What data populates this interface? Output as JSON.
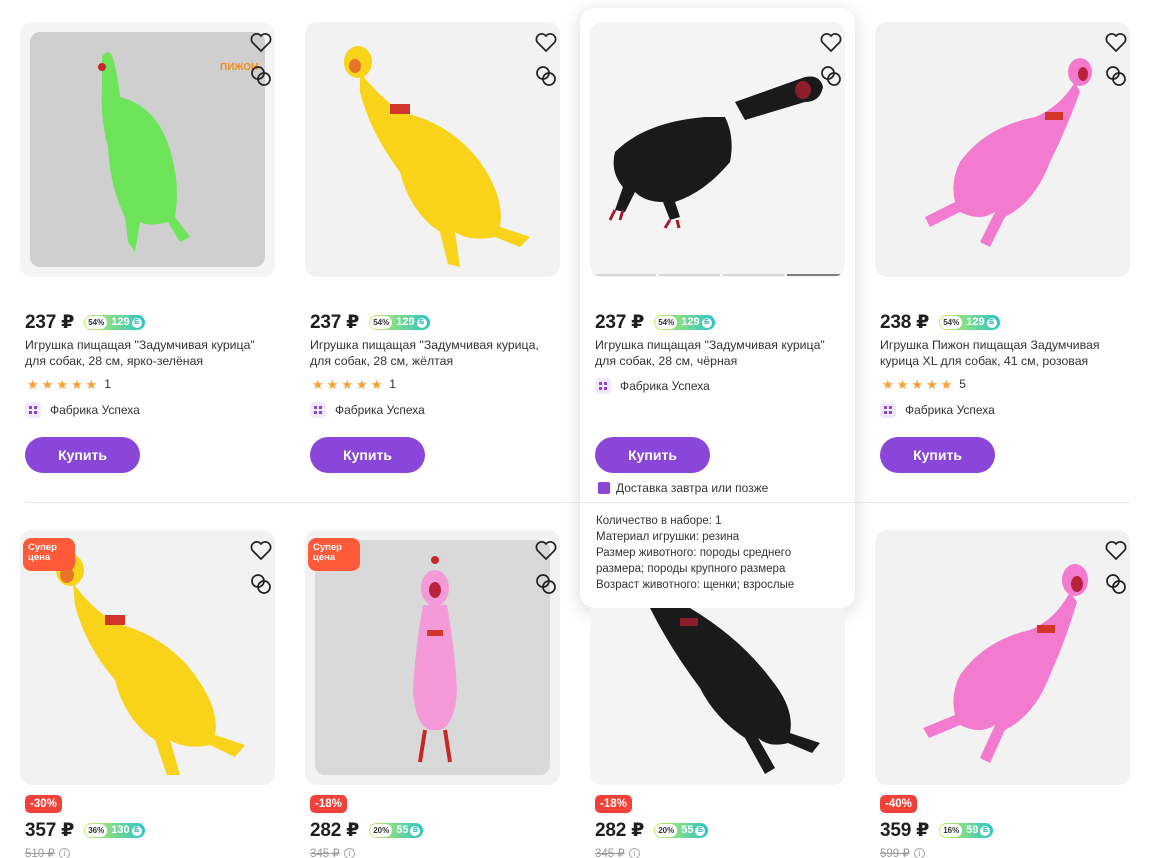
{
  "currency": "₽",
  "products": [
    {
      "price": "237 ₽",
      "bonus_pct": "54%",
      "bonus_amt": "129",
      "title": "Игрушка пищащая \"Задумчивая курица\" для собак, 28 см, ярко-зелёная",
      "rating_count": "1",
      "seller": "Фабрика Успеха",
      "buy": "Купить",
      "body_color": "#6ee45b",
      "brand_label": "ПИЖОН"
    },
    {
      "price": "237 ₽",
      "bonus_pct": "54%",
      "bonus_amt": "129",
      "title": "Игрушка пищащая \"Задумчивая курица, для собак, 28 см, жёлтая",
      "rating_count": "1",
      "seller": "Фабрика Успеха",
      "buy": "Купить",
      "body_color": "#f8d31a"
    },
    {
      "price": "237 ₽",
      "bonus_pct": "54%",
      "bonus_amt": "129",
      "title": "Игрушка пищащая \"Задумчивая курица\" для собак, 28 см, чёрная",
      "seller": "Фабрика Успеха",
      "buy": "Купить",
      "body_color": "#1a1a1a",
      "delivery": "Доставка завтра или позже",
      "specs": [
        "Количество в наборе: 1",
        "Материал игрушки: резина",
        "Размер животного: породы среднего размера; породы крупного размера",
        "Возраст животного: щенки; взрослые"
      ]
    },
    {
      "price": "238 ₽",
      "bonus_pct": "54%",
      "bonus_amt": "129",
      "title": "Игрушка Пижон пищащая Задумчивая курица XL для собак, 41 см, розовая",
      "rating_count": "5",
      "seller": "Фабрика Успеха",
      "buy": "Купить",
      "body_color": "#f27bd0"
    },
    {
      "promo": "Супер цена",
      "discount": "-30%",
      "price": "357 ₽",
      "bonus_pct": "36%",
      "bonus_amt": "130",
      "old_price": "510 ₽",
      "body_color": "#f8d31a"
    },
    {
      "promo": "Супер цена",
      "discount": "-18%",
      "price": "282 ₽",
      "bonus_pct": "20%",
      "bonus_amt": "55",
      "old_price": "345 ₽",
      "body_color": "#f59ad8"
    },
    {
      "discount": "-18%",
      "price": "282 ₽",
      "bonus_pct": "20%",
      "bonus_amt": "55",
      "old_price": "345 ₽",
      "body_color": "#1a1a1a"
    },
    {
      "discount": "-40%",
      "price": "359 ₽",
      "bonus_pct": "16%",
      "bonus_amt": "59",
      "old_price": "599 ₽",
      "body_color": "#f27bd0"
    }
  ],
  "icons": {
    "favorite": "heart-icon",
    "compare": "compare-icon",
    "seller": "seller-icon",
    "bonus": "bonus-coin-icon",
    "info": "info-icon",
    "delivery": "delivery-icon"
  },
  "colors": {
    "accent": "#8a46d8",
    "discount": "#f0423a",
    "promo": "#ff5a39",
    "stars": "#ff9e2c"
  }
}
